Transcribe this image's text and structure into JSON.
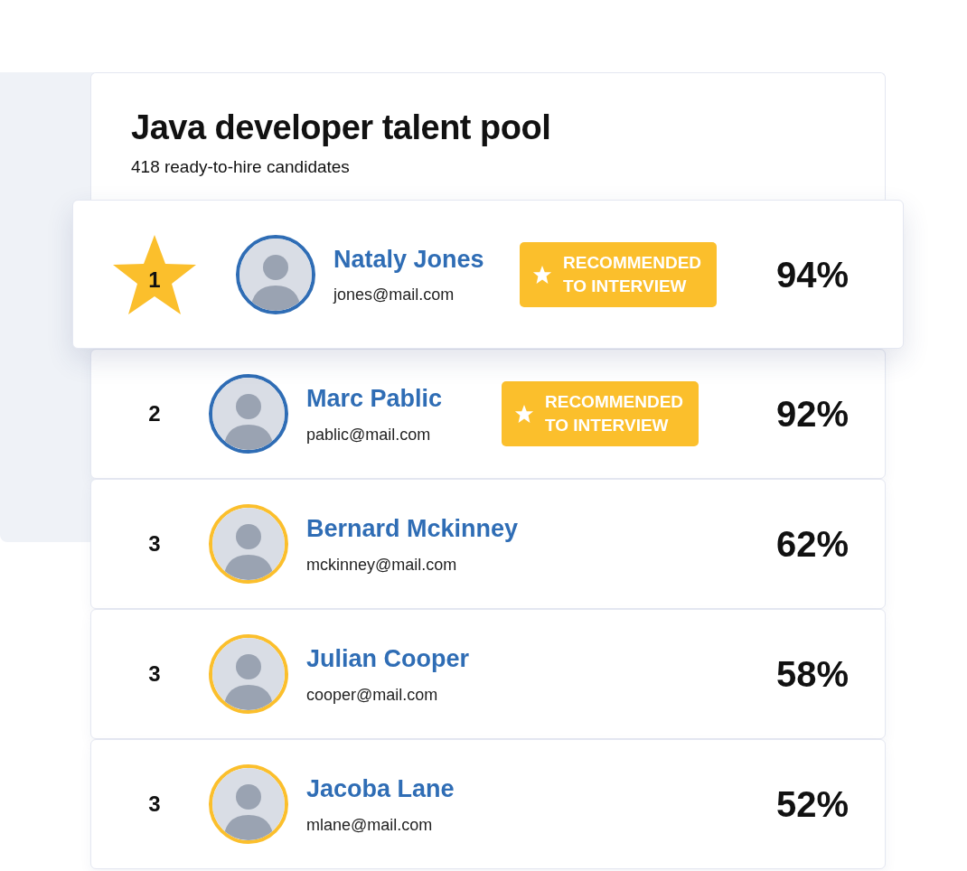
{
  "header": {
    "title": "Java developer talent pool",
    "subtitle": "418 ready-to-hire candidates"
  },
  "candidates": [
    {
      "rank": "1",
      "kind": "star",
      "highlighted": true,
      "name": "Nataly Jones",
      "email": "jones@mail.com",
      "color": "#2f6db5",
      "badge": "RECOMMENDED TO INTERVIEW",
      "score": "94%"
    },
    {
      "rank": "2",
      "kind": "plain",
      "highlighted": false,
      "name": "Marc Pablic",
      "email": "pablic@mail.com",
      "color": "#2f6db5",
      "badge": "RECOMMENDED TO INTERVIEW",
      "score": "92%"
    },
    {
      "rank": "3",
      "kind": "plain",
      "highlighted": false,
      "name": "Bernard Mckinney",
      "email": "mckinney@mail.com",
      "color": "#fbbf2c",
      "score": "62%"
    },
    {
      "rank": "3",
      "kind": "plain",
      "highlighted": false,
      "name": "Julian Cooper",
      "email": "cooper@mail.com",
      "color": "#fbbf2c",
      "score": "58%"
    },
    {
      "rank": "3",
      "kind": "plain",
      "highlighted": false,
      "name": "Jacoba Lane",
      "email": "mlane@mail.com",
      "color": "#fbbf2c",
      "score": "52%"
    }
  ]
}
